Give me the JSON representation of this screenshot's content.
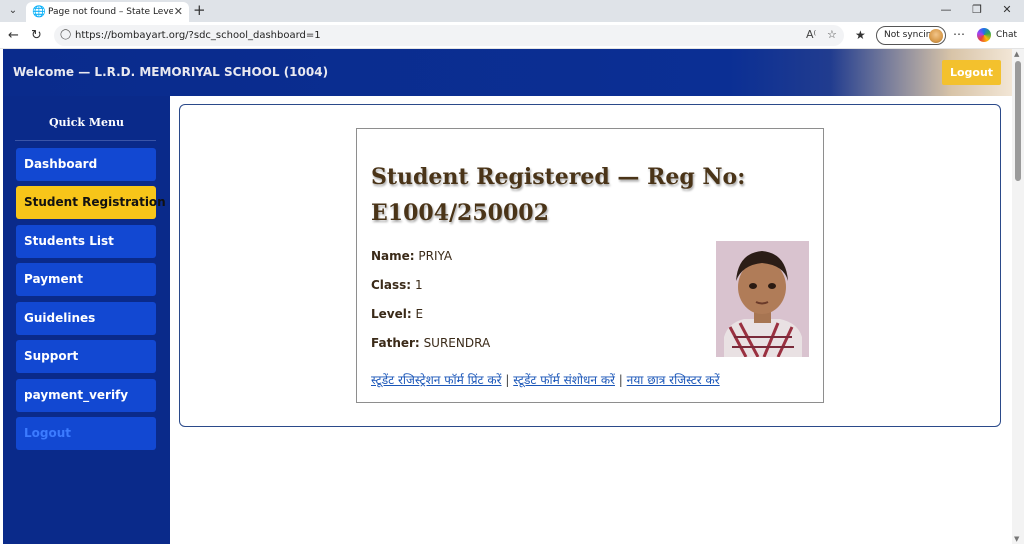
{
  "browser": {
    "tab_title": "Page not found – State Level Draw",
    "url": "https://bombayart.org/?sdc_school_dashboard=1",
    "sync_label": "Not syncing",
    "chat_label": "Chat",
    "icons": {
      "tab_list": "chevron-down-icon",
      "tab": "globe-icon",
      "close_tab": "close-icon",
      "new_tab": "plus-icon",
      "back": "back-arrow-icon",
      "reload": "reload-icon",
      "site_info": "lock-icon",
      "read_aloud": "read-aloud-icon",
      "favorite": "star-icon",
      "favorites": "favorites-icon",
      "more": "more-icon",
      "minimize": "minimize-icon",
      "restore": "restore-icon",
      "close_window": "close-icon"
    }
  },
  "header": {
    "welcome": "Welcome — L.R.D. MEMORIYAL SCHOOL (1004)",
    "logout": "Logout"
  },
  "sidebar": {
    "title": "Quick Menu",
    "items": [
      {
        "label": "Dashboard"
      },
      {
        "label": "Student Registration"
      },
      {
        "label": "Students List"
      },
      {
        "label": "Payment"
      },
      {
        "label": "Guidelines"
      },
      {
        "label": "Support"
      },
      {
        "label": "payment_verify"
      },
      {
        "label": "Logout"
      }
    ]
  },
  "student": {
    "title": "Student Registered — Reg No: E1004/250002",
    "fields": [
      {
        "label": "Name:",
        "value": "PRIYA"
      },
      {
        "label": "Class:",
        "value": "1"
      },
      {
        "label": "Level:",
        "value": "E"
      },
      {
        "label": "Father:",
        "value": "SURENDRA"
      }
    ],
    "links": [
      {
        "label": "स्टूडेंट रजिस्ट्रेशन फॉर्म प्रिंट करें"
      },
      {
        "label": "स्टूडेंट फॉर्म संशोधन करें"
      },
      {
        "label": "नया छात्र रजिस्टर करें"
      }
    ],
    "separator": "|"
  },
  "colors": {
    "sidebar_bg": "#0a2a8a",
    "menu_item_bg": "#1248d2",
    "active_item_bg": "#f7c519",
    "logout_bg": "#f3c12d",
    "link": "#1a56b8"
  }
}
